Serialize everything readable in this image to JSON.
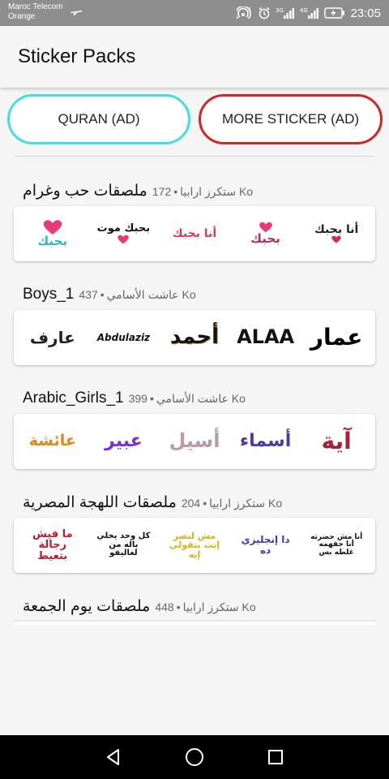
{
  "status": {
    "carrier_line1": "Maroc Telecom",
    "carrier_line2": "Orange",
    "network_3g": "3G",
    "network_4g": "4G",
    "hotspot_badge": "1",
    "time": "23:05"
  },
  "app": {
    "title": "Sticker Packs"
  },
  "ads": {
    "quran_label": "QURAN (AD)",
    "more_label": "MORE STICKER (AD)"
  },
  "colors": {
    "quran_border": "#3ee0e0",
    "more_border": "#d42424"
  },
  "packs": [
    {
      "name": "ملصقات حب وغرام",
      "author": "ستكرز ارابيا",
      "separator": "•",
      "size": "172 Ko",
      "stickers": [
        "بحبك",
        "بحبك موت",
        "أنا بحبك",
        "بحبك",
        "أنا بحبك"
      ],
      "sticker_icons": [
        "heart-love-sticker",
        "heart-text-sticker",
        "love-text-sticker",
        "heart-love-sticker",
        "heart-love-sticker"
      ]
    },
    {
      "name": "Boys_1",
      "author": "عاشت الأسامي",
      "separator": "•",
      "size": "437 Ko",
      "stickers": [
        "عارف",
        "Abdulaziz",
        "أحمد",
        "ALAA",
        "عمار"
      ]
    },
    {
      "name": "Arabic_Girls_1",
      "author": "عاشت الأسامي",
      "separator": "•",
      "size": "399 Ko",
      "stickers": [
        "عائشة",
        "عبير",
        "أسيل",
        "أسماء",
        "آية"
      ]
    },
    {
      "name": "ملصقات اللهجة المصرية",
      "author": "ستكرز ارابيا",
      "separator": "•",
      "size": "204 Ko",
      "stickers": [
        "ما فيش رجالة بتعيط",
        "كل وحد يخلي باله من لغاليفو",
        "مش لنصر إنت بتقولي إيه",
        "دا إنجليزي ده",
        "أنا مش حضرته أنا حقهمه غلطه بس"
      ]
    },
    {
      "name": "ملصقات يوم الجمعة",
      "author": "ستكرز ارابيا",
      "separator": "•",
      "size": "448 Ko",
      "stickers": []
    }
  ],
  "nav": {
    "back_icon": "back-icon",
    "home_icon": "home-icon",
    "recents_icon": "recents-icon"
  }
}
